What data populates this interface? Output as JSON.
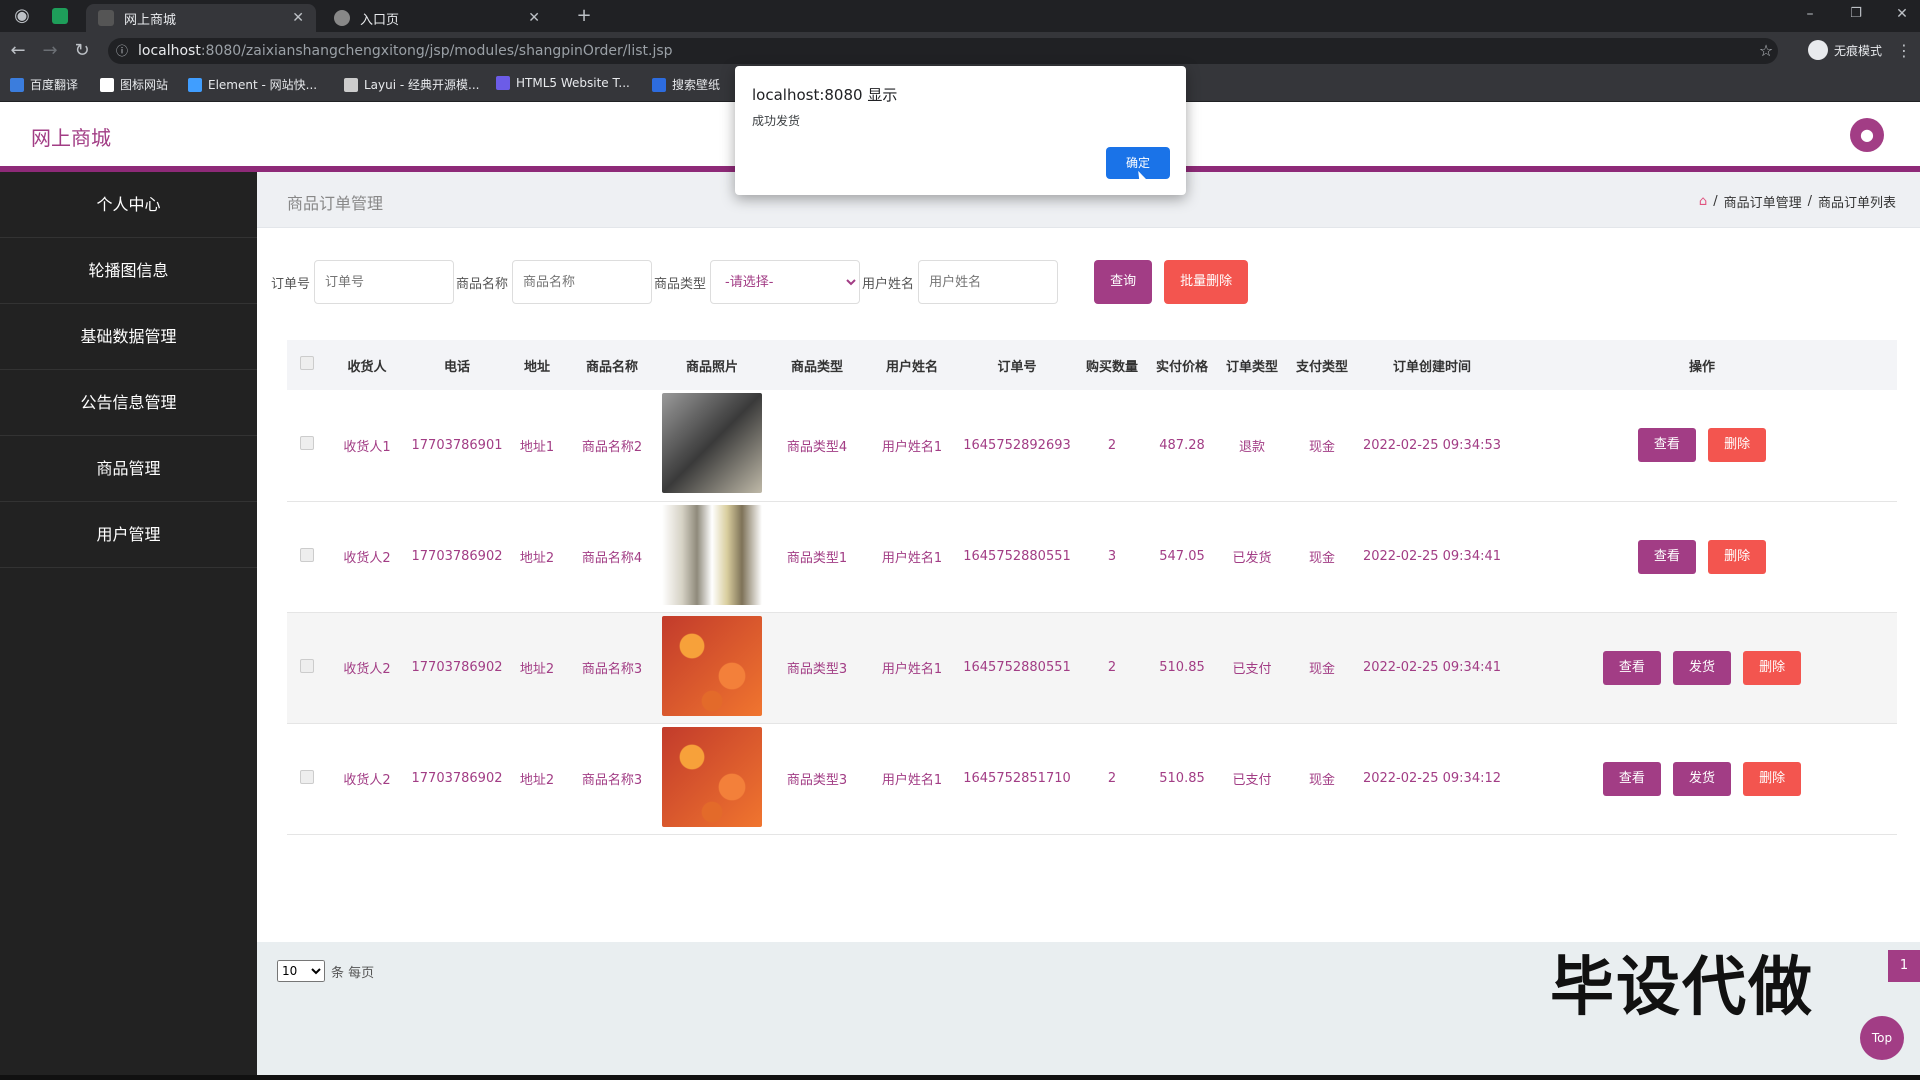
{
  "browser": {
    "tabs": [
      {
        "title": "网上商城",
        "active": true
      },
      {
        "title": "入口页",
        "active": false
      }
    ],
    "url_host": "localhost",
    "url_path": ":8080/zaixianshangchengxitong/jsp/modules/shangpinOrder/list.jsp",
    "incognito_label": "无痕模式",
    "bookmarks": [
      "百度翻译",
      "图标网站",
      "Element - 网站快...",
      "Layui - 经典开源模...",
      "HTML5 Website T...",
      "搜索壁纸"
    ]
  },
  "app": {
    "brand": "网上商城",
    "avatar_icon": "user-icon"
  },
  "sidebar": {
    "items": [
      "个人中心",
      "轮播图信息",
      "基础数据管理",
      "公告信息管理",
      "商品管理",
      "用户管理"
    ]
  },
  "page": {
    "title": "商品订单管理",
    "breadcrumb": [
      "商品订单管理",
      "商品订单列表"
    ]
  },
  "search": {
    "order_label": "订单号",
    "order_placeholder": "订单号",
    "name_label": "商品名称",
    "name_placeholder": "商品名称",
    "type_label": "商品类型",
    "type_selected": "-请选择-",
    "user_label": "用户姓名",
    "user_placeholder": "用户姓名",
    "query_btn": "查询",
    "batch_delete_btn": "批量删除"
  },
  "table": {
    "headers": [
      "收货人",
      "电话",
      "地址",
      "商品名称",
      "商品照片",
      "商品类型",
      "用户姓名",
      "订单号",
      "购买数量",
      "实付价格",
      "订单类型",
      "支付类型",
      "订单创建时间",
      "操作"
    ],
    "rows": [
      {
        "receiver": "收货人1",
        "phone": "17703786901",
        "address": "地址1",
        "product": "商品名称2",
        "photo": "phone",
        "ptype": "商品类型4",
        "user": "用户姓名1",
        "order_no": "1645752892693",
        "qty": "2",
        "price": "487.28",
        "order_type": "退款",
        "pay_type": "现金",
        "created": "2022-02-25 09:34:53",
        "ops": [
          "查看",
          "删除"
        ]
      },
      {
        "receiver": "收货人2",
        "phone": "17703786902",
        "address": "地址2",
        "product": "商品名称4",
        "photo": "bottle",
        "ptype": "商品类型1",
        "user": "用户姓名1",
        "order_no": "1645752880551",
        "qty": "3",
        "price": "547.05",
        "order_type": "已发货",
        "pay_type": "现金",
        "created": "2022-02-25 09:34:41",
        "ops": [
          "查看",
          "删除"
        ]
      },
      {
        "receiver": "收货人2",
        "phone": "17703786902",
        "address": "地址2",
        "product": "商品名称3",
        "photo": "flower",
        "ptype": "商品类型3",
        "user": "用户姓名1",
        "order_no": "1645752880551",
        "qty": "2",
        "price": "510.85",
        "order_type": "已支付",
        "pay_type": "现金",
        "created": "2022-02-25 09:34:41",
        "ops": [
          "查看",
          "发货",
          "删除"
        ]
      },
      {
        "receiver": "收货人2",
        "phone": "17703786902",
        "address": "地址2",
        "product": "商品名称3",
        "photo": "flower",
        "ptype": "商品类型3",
        "user": "用户姓名1",
        "order_no": "1645752851710",
        "qty": "2",
        "price": "510.85",
        "order_type": "已支付",
        "pay_type": "现金",
        "created": "2022-02-25 09:34:12",
        "ops": [
          "查看",
          "发货",
          "删除"
        ]
      }
    ]
  },
  "pager": {
    "page_size": "10",
    "per_page_label": "条 每页",
    "current_page": "1"
  },
  "dialog": {
    "title": "localhost:8080 显示",
    "message": "成功发货",
    "ok": "确定"
  },
  "overlay": {
    "watermark": "毕设代做",
    "top_btn": "Top"
  },
  "colors": {
    "brand": "#a23d85",
    "danger": "#f3554f",
    "sidebar": "#222222"
  }
}
